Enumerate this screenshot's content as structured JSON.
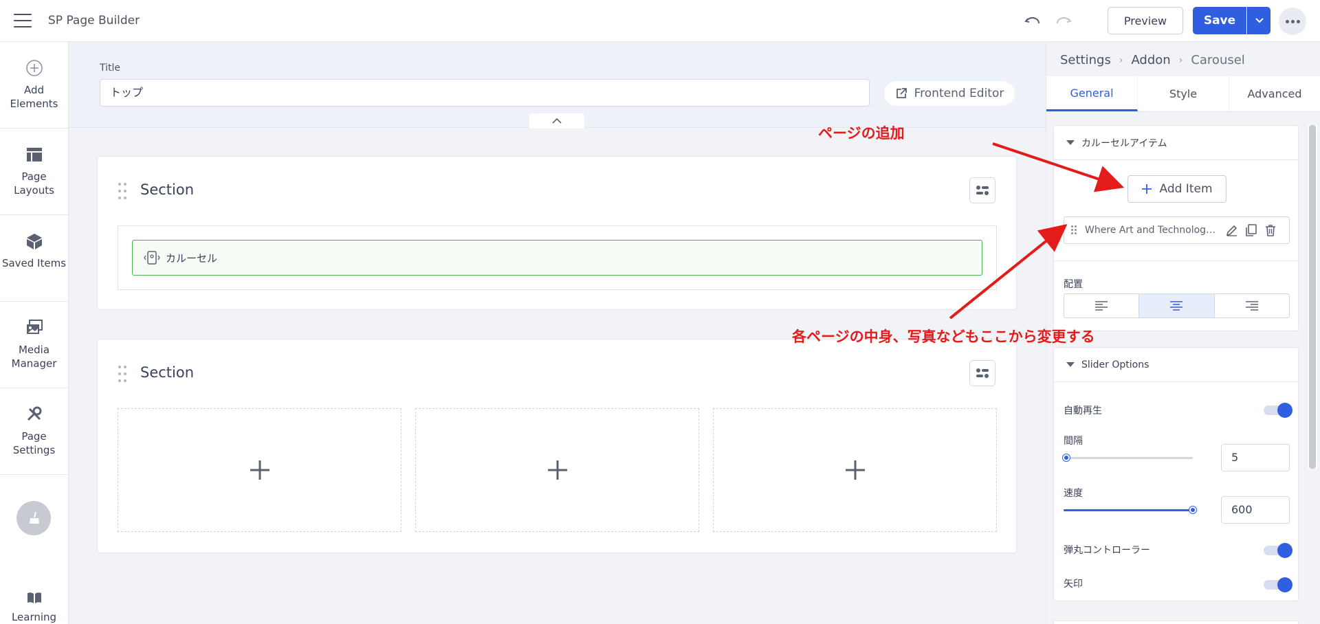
{
  "app": {
    "title": "SP Page Builder"
  },
  "toolbar": {
    "preview_label": "Preview",
    "save_label": "Save"
  },
  "sidebar": {
    "items": [
      {
        "label": "Add Elements",
        "icon": "plus-circle-icon"
      },
      {
        "label": "Page Layouts",
        "icon": "layout-icon"
      },
      {
        "label": "Saved Items",
        "icon": "cube-icon"
      },
      {
        "label": "Media Manager",
        "icon": "images-icon"
      },
      {
        "label": "Page Settings",
        "icon": "tools-icon"
      }
    ],
    "learning_label": "Learning"
  },
  "page": {
    "title_label": "Title",
    "title_value": "トップ",
    "frontend_editor_label": "Frontend Editor"
  },
  "canvas": {
    "sections": [
      {
        "title": "Section",
        "addon_label": "カルーセル"
      },
      {
        "title": "Section"
      }
    ]
  },
  "panel": {
    "breadcrumb": [
      "Settings",
      "Addon",
      "Carousel"
    ],
    "tabs": [
      "General",
      "Style",
      "Advanced"
    ],
    "active_tab": "General",
    "items_card": {
      "header": "カルーセルアイテム",
      "add_item_label": "Add Item",
      "items": [
        "Where Art and Technology ..."
      ],
      "alignment_label": "配置",
      "alignment_selected": "center"
    },
    "slider_card": {
      "header": "Slider Options",
      "autoplay_label": "自動再生",
      "autoplay": true,
      "interval_label": "間隔",
      "interval_value": "5",
      "interval_fraction": 0.02,
      "speed_label": "速度",
      "speed_value": "600",
      "speed_fraction": 1.0,
      "bullets_label": "弾丸コントローラー",
      "bullets": true,
      "arrows_label": "矢印",
      "arrows": true
    }
  },
  "annotations": {
    "add_page": "ページの追加",
    "edit_content": "各ページの中身、写真などもここから変更する"
  },
  "colors": {
    "accent": "#2f5fe0",
    "annotation": "#e41b1b",
    "addon_border": "#4caf50"
  }
}
